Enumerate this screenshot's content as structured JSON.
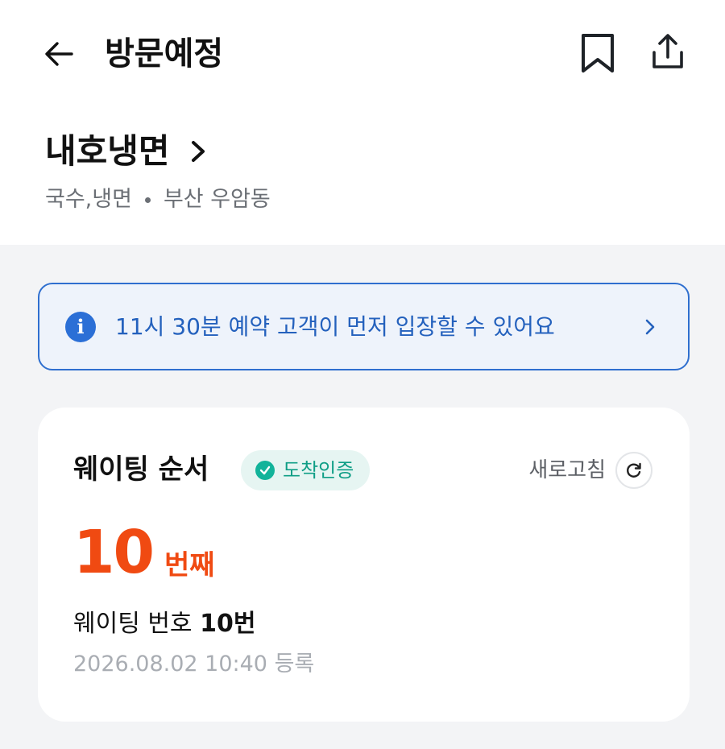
{
  "header": {
    "title": "방문예정"
  },
  "store": {
    "name": "내호냉면",
    "category": "국수,냉면",
    "location": "부산 우암동"
  },
  "notice": {
    "text": "11시 30분 예약 고객이 먼저 입장할 수 있어요"
  },
  "waiting": {
    "title": "웨이팅 순서",
    "badge": "도착인증",
    "refresh_label": "새로고침",
    "order_number": "10",
    "order_unit": "번째",
    "number_label": "웨이팅 번호",
    "number_value": "10번",
    "registered": "2026.08.02 10:40 등록"
  },
  "colors": {
    "accent_orange": "#f04a12",
    "notice_blue": "#2461bd",
    "badge_teal": "#12b39a"
  },
  "icons": [
    "back-arrow-icon",
    "bookmark-icon",
    "share-icon",
    "chevron-right-icon",
    "info-icon",
    "check-circle-icon",
    "refresh-icon"
  ]
}
